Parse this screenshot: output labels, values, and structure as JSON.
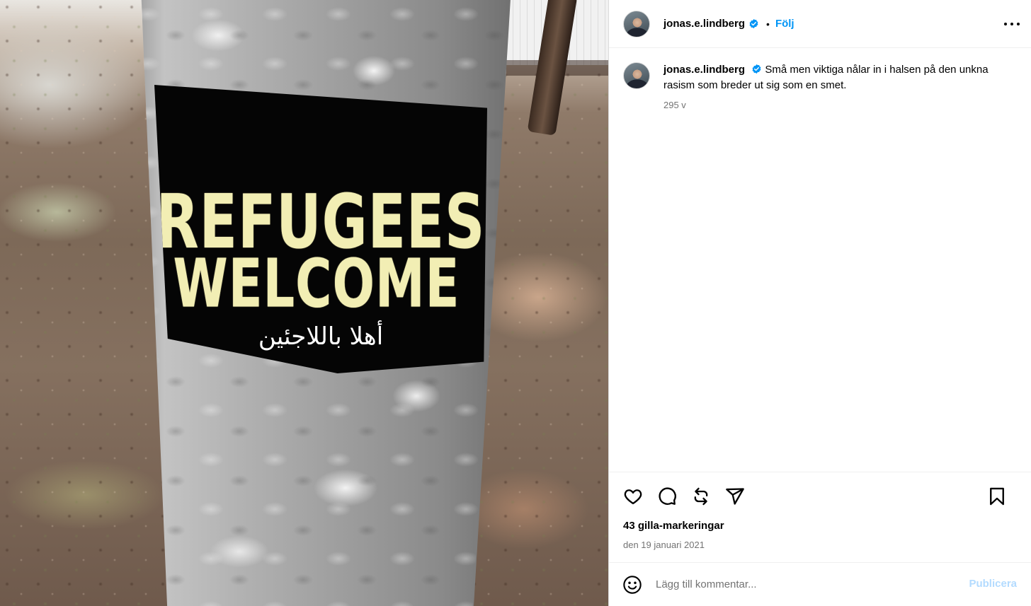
{
  "photo": {
    "sticker_line1": "REFUGEES",
    "sticker_line2": "WELCOME",
    "sticker_arabic": "أهلا باللاجئين"
  },
  "header": {
    "username": "jonas.e.lindberg",
    "separator": "•",
    "follow_label": "Följ"
  },
  "caption": {
    "username": "jonas.e.lindberg",
    "text": "Små men viktiga nålar in i halsen på den unkna rasism som breder ut sig som en smet.",
    "time_ago": "295 v"
  },
  "stats": {
    "likes": "43 gilla-markeringar",
    "date": "den 19 januari 2021"
  },
  "comment_box": {
    "placeholder": "Lägg till kommentar...",
    "publish_label": "Publicera"
  },
  "colors": {
    "accent": "#0095f6",
    "publish_disabled": "#b3dbff",
    "secondary_text": "#737373",
    "sticker_text": "#f2eeb4"
  },
  "icons": {
    "like": "heart-icon",
    "comment": "comment-icon",
    "repost": "repost-icon",
    "share": "share-icon",
    "save": "bookmark-icon",
    "emoji": "emoji-icon",
    "more": "more-options-icon",
    "verified": "verified-badge-icon"
  }
}
